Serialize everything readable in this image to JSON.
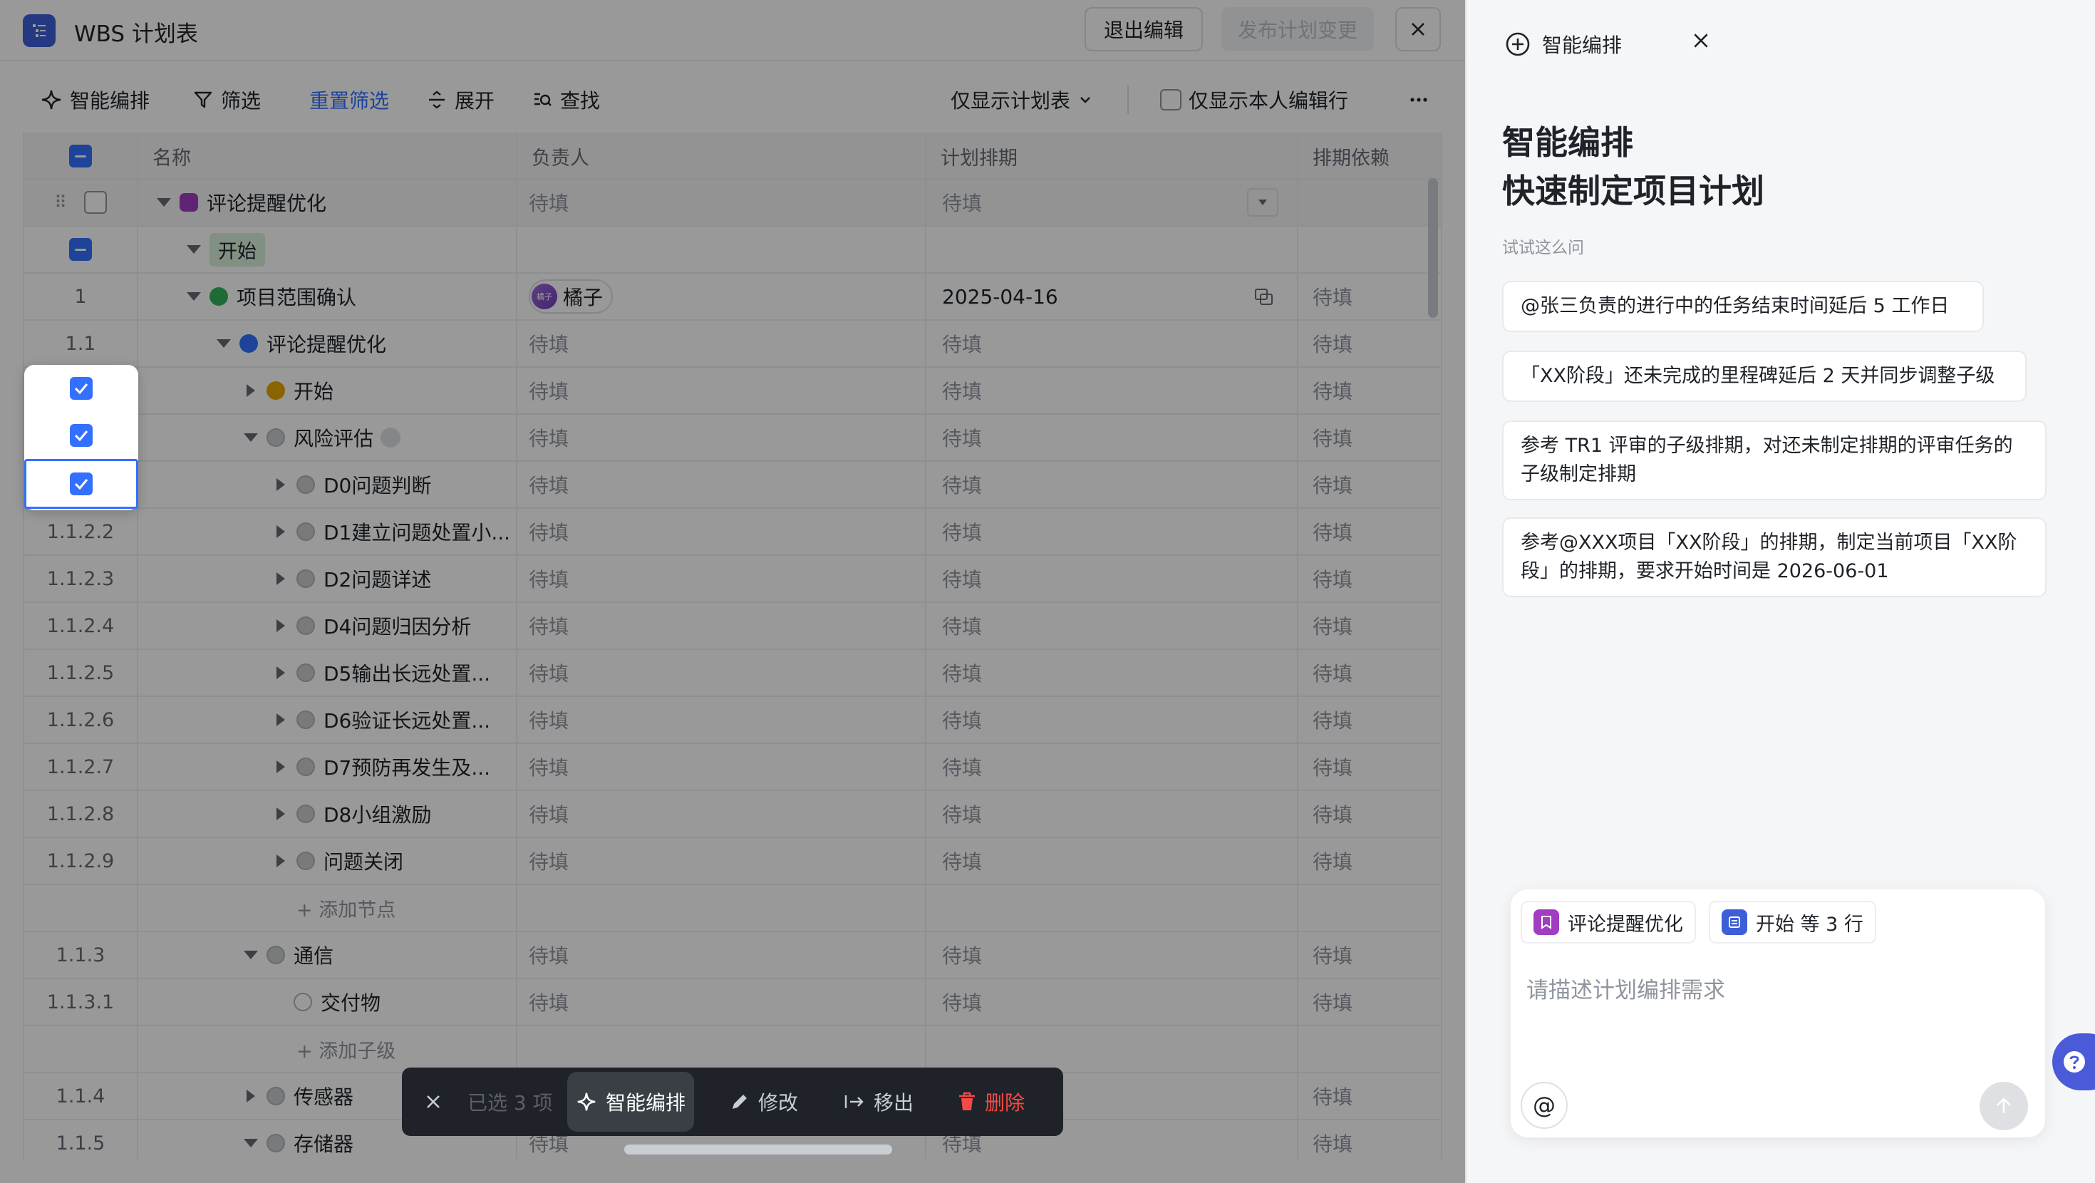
{
  "header": {
    "title": "WBS 计划表",
    "exit_label": "退出编辑",
    "publish_label": "发布计划变更"
  },
  "toolbar": {
    "smart": "智能编排",
    "filter": "筛选",
    "reset_filter": "重置筛选",
    "expand": "展开",
    "find": "查找",
    "view_select": "仅显示计划表",
    "only_mine": "仅显示本人编辑行"
  },
  "table": {
    "columns": [
      "名称",
      "负责人",
      "计划排期",
      "排期依赖"
    ],
    "placeholder": "待填",
    "rows": [
      {
        "num": "",
        "name": "评论提醒优化",
        "owner": "待填",
        "date": "待填",
        "dep": ""
      },
      {
        "num": "",
        "name": "开始",
        "owner": "",
        "date": "",
        "dep": ""
      },
      {
        "num": "1",
        "name": "项目范围确认",
        "owner": "橘子",
        "owner_avatar": "橘子",
        "date": "2025-04-16",
        "dep": "待填"
      },
      {
        "num": "1.1",
        "name": "评论提醒优化",
        "owner": "待填",
        "date": "待填",
        "dep": "待填"
      },
      {
        "num": "",
        "name": "开始",
        "owner": "待填",
        "date": "待填",
        "dep": "待填"
      },
      {
        "num": "",
        "name": "风险评估",
        "owner": "待填",
        "date": "待填",
        "dep": "待填"
      },
      {
        "num": "",
        "name": "D0问题判断",
        "owner": "待填",
        "date": "待填",
        "dep": "待填"
      },
      {
        "num": "1.1.2.2",
        "name": "D1建立问题处置小...",
        "owner": "待填",
        "date": "待填",
        "dep": "待填"
      },
      {
        "num": "1.1.2.3",
        "name": "D2问题详述",
        "owner": "待填",
        "date": "待填",
        "dep": "待填"
      },
      {
        "num": "1.1.2.4",
        "name": "D4问题归因分析",
        "owner": "待填",
        "date": "待填",
        "dep": "待填"
      },
      {
        "num": "1.1.2.5",
        "name": "D5输出长远处置...",
        "owner": "待填",
        "date": "待填",
        "dep": "待填"
      },
      {
        "num": "1.1.2.6",
        "name": "D6验证长远处置...",
        "owner": "待填",
        "date": "待填",
        "dep": "待填"
      },
      {
        "num": "1.1.2.7",
        "name": "D7预防再发生及...",
        "owner": "待填",
        "date": "待填",
        "dep": "待填"
      },
      {
        "num": "1.1.2.8",
        "name": "D8小组激励",
        "owner": "待填",
        "date": "待填",
        "dep": "待填"
      },
      {
        "num": "1.1.2.9",
        "name": "问题关闭",
        "owner": "待填",
        "date": "待填",
        "dep": "待填"
      },
      {
        "num": "",
        "name": "+ 添加节点",
        "owner": "",
        "date": "",
        "dep": ""
      },
      {
        "num": "1.1.3",
        "name": "通信",
        "owner": "待填",
        "date": "待填",
        "dep": "待填"
      },
      {
        "num": "1.1.3.1",
        "name": "交付物",
        "owner": "待填",
        "date": "待填",
        "dep": "待填"
      },
      {
        "num": "",
        "name": "+ 添加子级",
        "owner": "",
        "date": "",
        "dep": ""
      },
      {
        "num": "1.1.4",
        "name": "传感器",
        "owner": "待填",
        "date": "",
        "dep": "待填"
      },
      {
        "num": "1.1.5",
        "name": "存储器",
        "owner": "待填",
        "date": "待填",
        "dep": "待填"
      }
    ]
  },
  "actionbar": {
    "selected": "已选 3 项",
    "smart": "智能编排",
    "edit": "修改",
    "move": "移出",
    "delete": "删除"
  },
  "panel": {
    "head": "智能编排",
    "title_line1": "智能编排",
    "title_line2": "快速制定项目计划",
    "hint": "试试这么问",
    "suggestions": [
      "@张三负责的进行中的任务结束时间延后 5 工作日",
      "「XX阶段」还未完成的里程碑延后 2 天并同步调整子级",
      "参考 TR1 评审的子级排期，对还未制定排期的评审任务的子级制定排期",
      "参考@XXX项目「XX阶段」的排期，制定当前项目「XX阶段」的排期，要求开始时间是 2026-06-01"
    ],
    "chips": [
      "评论提醒优化",
      "开始 等 3 行"
    ],
    "input_placeholder": "请描述计划编排需求",
    "at_symbol": "@"
  },
  "colors": {
    "accent": "#3370ff",
    "danger": "#f54a45",
    "tag_green": "#d9f0dc"
  }
}
